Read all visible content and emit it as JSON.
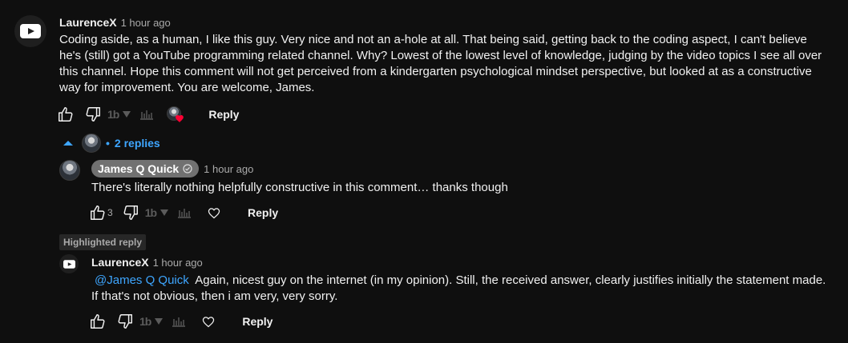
{
  "comment": {
    "author": "LaurenceX",
    "time": "1 hour ago",
    "text": "Coding aside, as a human, I like this guy. Very nice and not an a-hole at all. That being said, getting back to the coding aspect, I can't believe he's (still) got a YouTube programming related channel. Why? Lowest of the lowest level of knowledge, judging by the video topics I see all over this channel. Hope this comment will not get perceived from a kindergarten psychological mindset perspective, but looked at as a constructive way for improvement. You are welcome, James.",
    "reply_label": "Reply",
    "ext_label": "1b"
  },
  "replies_toggle": {
    "separator": "•",
    "label": "2 replies"
  },
  "reply1": {
    "author": "James Q Quick",
    "time": "1 hour ago",
    "text": "There's literally nothing helpfully constructive in this comment… thanks though",
    "like_count": "3",
    "reply_label": "Reply",
    "ext_label": "1b"
  },
  "highlighted": {
    "label": "Highlighted reply"
  },
  "reply2": {
    "author": "LaurenceX",
    "time": "1 hour ago",
    "mention": "@James Q Quick",
    "text": "Again, nicest guy on the internet (in my opinion). Still, the received answer, clearly justifies initially the statement made. If that's not obvious, then i am very, very sorry.",
    "reply_label": "Reply",
    "ext_label": "1b"
  },
  "colors": {
    "background": "#0f0f0f",
    "link": "#3ea6ff",
    "heart": "#ff0033"
  }
}
